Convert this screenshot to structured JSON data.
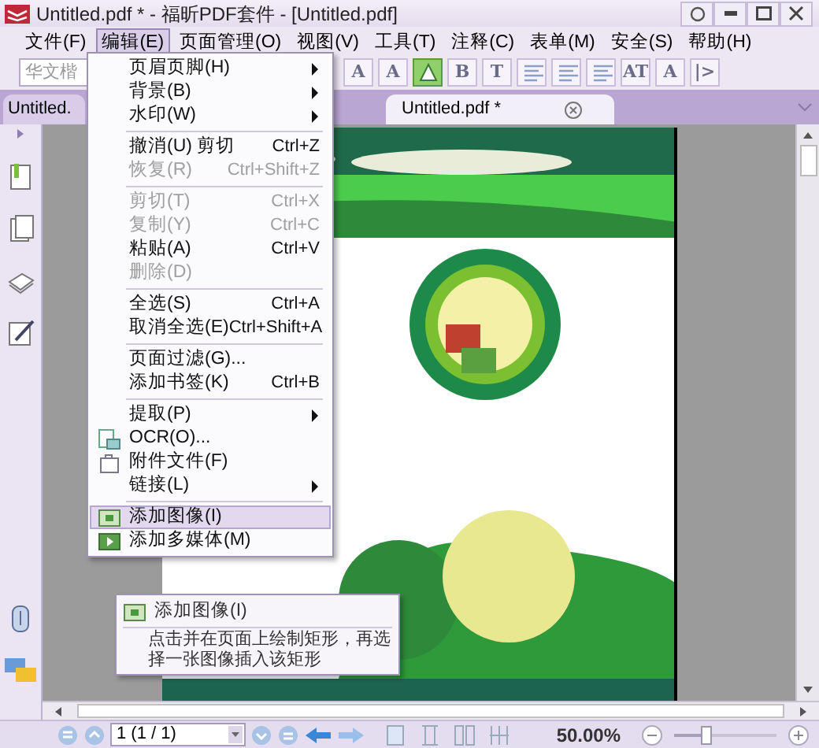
{
  "window": {
    "title": "Untitled.pdf * - 福昕PDF套件 - [Untitled.pdf]"
  },
  "menu_bar": [
    {
      "label": "文件(F)",
      "selected": false
    },
    {
      "label": "编辑(E)",
      "selected": true
    },
    {
      "label": "页面管理(O)",
      "selected": false
    },
    {
      "label": "视图(V)",
      "selected": false
    },
    {
      "label": "工具(T)",
      "selected": false
    },
    {
      "label": "注释(C)",
      "selected": false
    },
    {
      "label": "表单(M)",
      "selected": false
    },
    {
      "label": "安全(S)",
      "selected": false
    },
    {
      "label": "帮助(H)",
      "selected": false
    }
  ],
  "font_field": {
    "value": "华文楷"
  },
  "toolbar": [
    {
      "kind": "letter",
      "text": "A",
      "selected": false
    },
    {
      "kind": "letter",
      "text": "A",
      "selected": false
    },
    {
      "kind": "shape",
      "selected": true
    },
    {
      "kind": "letter",
      "text": "B",
      "selected": false
    },
    {
      "kind": "letter",
      "text": "T",
      "selected": false
    },
    {
      "kind": "align",
      "selected": false
    },
    {
      "kind": "align",
      "selected": false
    },
    {
      "kind": "align",
      "selected": false
    },
    {
      "kind": "letter",
      "text": "AT",
      "selected": false
    },
    {
      "kind": "letter",
      "text": "A",
      "selected": false
    },
    {
      "kind": "letter",
      "text": "|>",
      "selected": false
    }
  ],
  "tabs": [
    {
      "label": "Untitled.",
      "selected": false
    },
    {
      "label": "Untitled.pdf *",
      "selected": true
    }
  ],
  "edit_menu": [
    {
      "kind": "item",
      "label": "页眉页脚(H)",
      "submenu": true,
      "disabled": false,
      "selected": false
    },
    {
      "kind": "item",
      "label": "背景(B)",
      "submenu": true,
      "disabled": false,
      "selected": false
    },
    {
      "kind": "item",
      "label": "水印(W)",
      "submenu": true,
      "disabled": false,
      "selected": false
    },
    {
      "kind": "separator"
    },
    {
      "kind": "item",
      "label": "撤消(U) 剪切",
      "shortcut": "Ctrl+Z",
      "submenu": false,
      "disabled": false,
      "selected": false
    },
    {
      "kind": "item",
      "label": "恢复(R)",
      "shortcut": "Ctrl+Shift+Z",
      "submenu": false,
      "disabled": true,
      "selected": false
    },
    {
      "kind": "separator"
    },
    {
      "kind": "item",
      "label": "剪切(T)",
      "shortcut": "Ctrl+X",
      "submenu": false,
      "disabled": true,
      "selected": false
    },
    {
      "kind": "item",
      "label": "复制(Y)",
      "shortcut": "Ctrl+C",
      "submenu": false,
      "disabled": true,
      "selected": false
    },
    {
      "kind": "item",
      "label": "粘贴(A)",
      "shortcut": "Ctrl+V",
      "submenu": false,
      "disabled": false,
      "selected": false
    },
    {
      "kind": "item",
      "label": "删除(D)",
      "submenu": false,
      "disabled": true,
      "selected": false
    },
    {
      "kind": "separator"
    },
    {
      "kind": "item",
      "label": "全选(S)",
      "shortcut": "Ctrl+A",
      "submenu": false,
      "disabled": false,
      "selected": false
    },
    {
      "kind": "item",
      "label": "取消全选(E)",
      "shortcut": "Ctrl+Shift+A",
      "submenu": false,
      "disabled": false,
      "selected": false
    },
    {
      "kind": "separator"
    },
    {
      "kind": "item",
      "label": "页面过滤(G)...",
      "submenu": false,
      "disabled": false,
      "selected": false
    },
    {
      "kind": "item",
      "label": "添加书签(K)",
      "shortcut": "Ctrl+B",
      "submenu": false,
      "disabled": false,
      "selected": false
    },
    {
      "kind": "separator"
    },
    {
      "kind": "item",
      "label": "提取(P)",
      "submenu": true,
      "disabled": false,
      "selected": false
    },
    {
      "kind": "item",
      "label": "OCR(O)...",
      "submenu": false,
      "disabled": false,
      "selected": false
    },
    {
      "kind": "item",
      "label": "附件文件(F)",
      "submenu": false,
      "disabled": false,
      "selected": false
    },
    {
      "kind": "item",
      "label": "链接(L)",
      "submenu": true,
      "disabled": false,
      "selected": false
    },
    {
      "kind": "separator"
    },
    {
      "kind": "item",
      "label": "添加图像(I)",
      "submenu": false,
      "disabled": false,
      "selected": true
    },
    {
      "kind": "item",
      "label": "添加多媒体(M)",
      "submenu": false,
      "disabled": false,
      "selected": false
    }
  ],
  "tooltip": {
    "title": "添加图像(I)",
    "text": "点击并在页面上绘制矩形，再选择一张图像插入该矩形"
  },
  "status_bar": {
    "page_field": {
      "value": "1 (1 / 1)"
    },
    "zoom": "50.00%",
    "zoom_slider": {
      "level": 0.3
    }
  }
}
